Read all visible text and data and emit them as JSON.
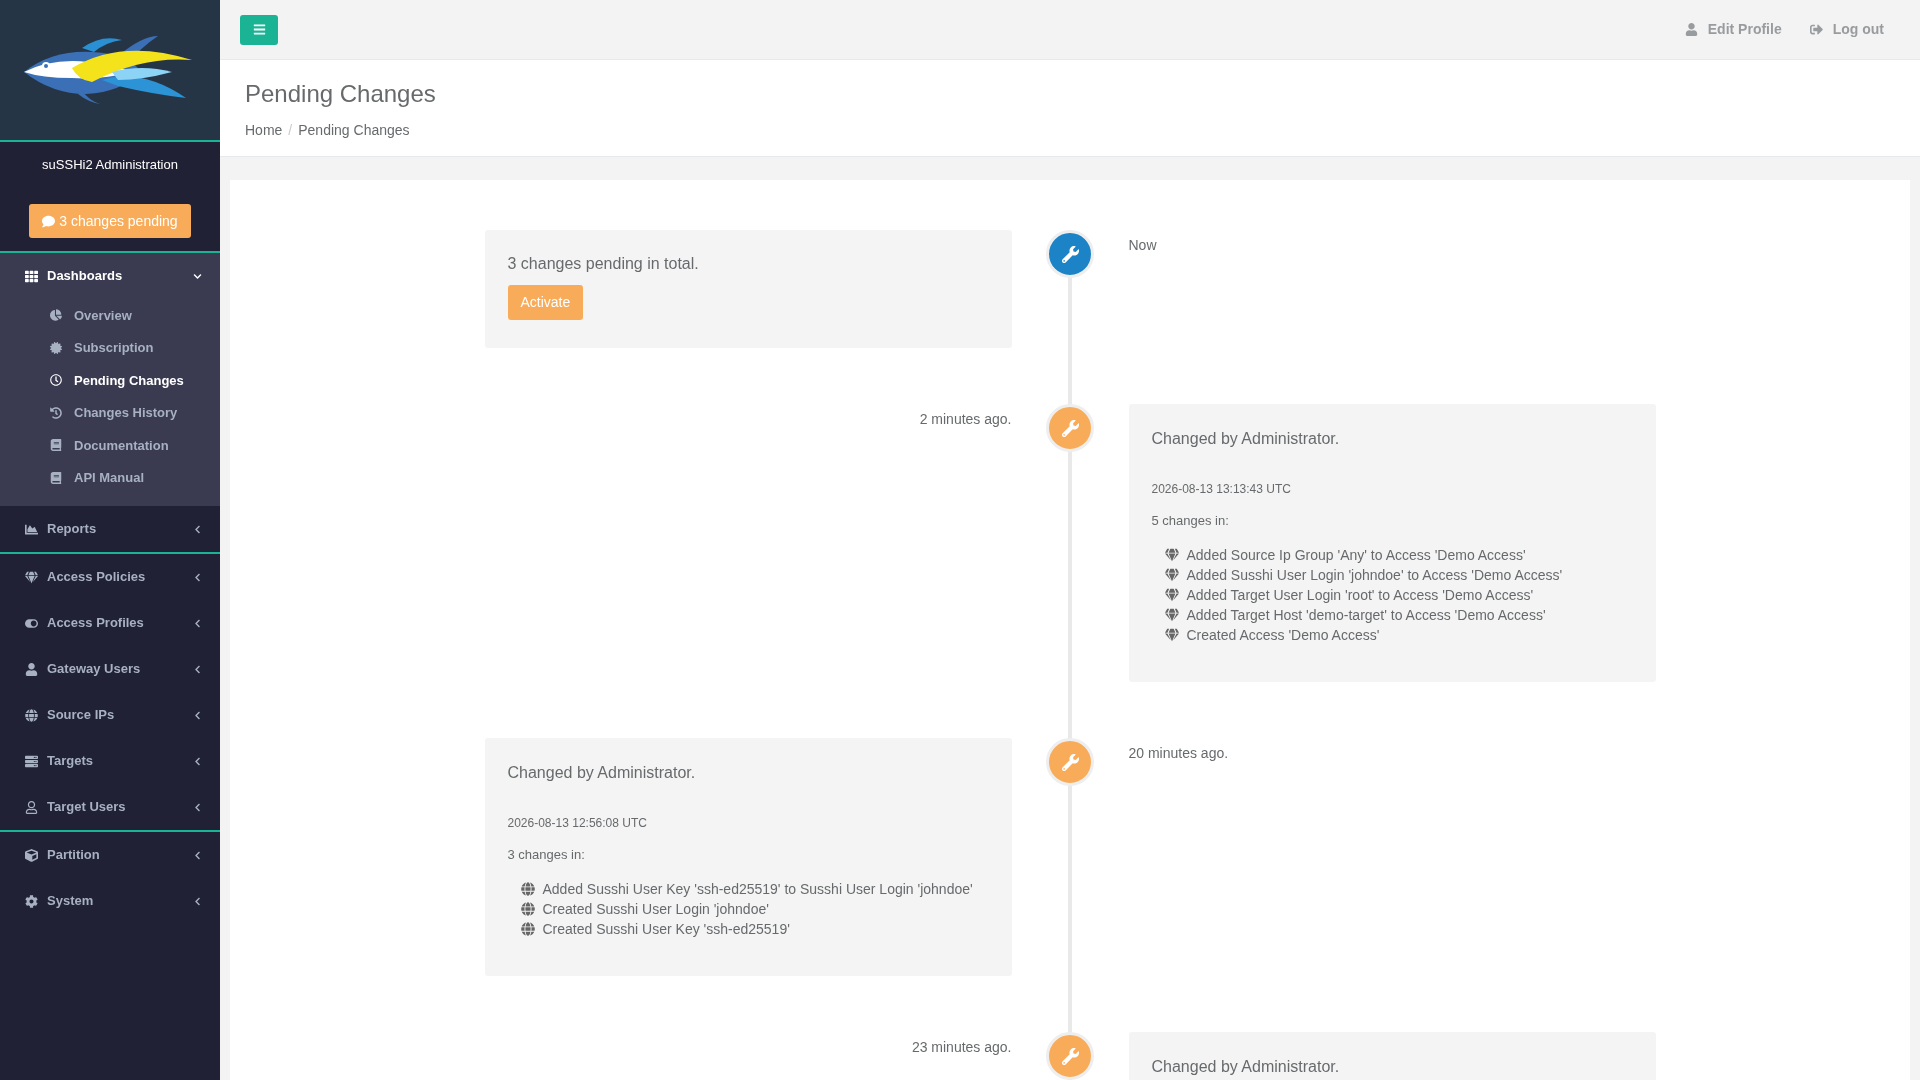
{
  "sidebar": {
    "title": "suSSHi2 Administration",
    "pending_button": "3 changes pending",
    "groups": [
      [
        {
          "label": "Dashboards",
          "expanded": true,
          "children": [
            {
              "label": "Overview",
              "selected": false
            },
            {
              "label": "Subscription",
              "selected": false
            },
            {
              "label": "Pending Changes",
              "selected": true
            },
            {
              "label": "Changes History",
              "selected": false
            },
            {
              "label": "Documentation",
              "selected": false
            },
            {
              "label": "API Manual",
              "selected": false
            }
          ]
        },
        {
          "label": "Reports",
          "expanded": false
        }
      ],
      [
        {
          "label": "Access Policies",
          "expanded": false
        },
        {
          "label": "Access Profiles",
          "expanded": false
        },
        {
          "label": "Gateway Users",
          "expanded": false
        },
        {
          "label": "Source IPs",
          "expanded": false
        },
        {
          "label": "Targets",
          "expanded": false
        },
        {
          "label": "Target Users",
          "expanded": false
        }
      ],
      [
        {
          "label": "Partition",
          "expanded": false
        },
        {
          "label": "System",
          "expanded": false
        }
      ]
    ]
  },
  "topbar": {
    "links": [
      "Edit Profile",
      "Log out"
    ]
  },
  "header": {
    "title": "Pending Changes",
    "breadcrumb": [
      "Home",
      "Pending Changes"
    ],
    "separator": "/"
  },
  "timeline": [
    {
      "kind": "pending",
      "color": "#1c84c6",
      "time": "Now",
      "text": "3 changes pending in total.",
      "button": "Activate"
    },
    {
      "kind": "change",
      "color": "#f8ac59",
      "time": "2 minutes ago.",
      "title": "Changed by Administrator.",
      "date": "2026-08-13 13:13:43 UTC",
      "count": "5 changes in:",
      "changes": [
        {
          "kind": "access",
          "text": "Added Source Ip Group 'Any' to Access 'Demo Access'"
        },
        {
          "kind": "access",
          "text": "Added Susshi User Login 'johndoe' to Access 'Demo Access'"
        },
        {
          "kind": "access",
          "text": "Added Target User Login 'root' to Access 'Demo Access'"
        },
        {
          "kind": "access",
          "text": "Added Target Host 'demo-target' to Access 'Demo Access'"
        },
        {
          "kind": "access",
          "text": "Created Access 'Demo Access'"
        }
      ]
    },
    {
      "kind": "change",
      "color": "#f8ac59",
      "time": "20 minutes ago.",
      "title": "Changed by Administrator.",
      "date": "2026-08-13 12:56:08 UTC",
      "count": "3 changes in:",
      "changes": [
        {
          "kind": "user",
          "text": "Added Susshi User Key 'ssh-ed25519' to Susshi User Login 'johndoe'"
        },
        {
          "kind": "user",
          "text": "Created Susshi User Login 'johndoe'"
        },
        {
          "kind": "user",
          "text": "Created Susshi User Key 'ssh-ed25519'"
        }
      ]
    },
    {
      "kind": "change",
      "color": "#f8ac59",
      "time": "23 minutes ago.",
      "title": "Changed by Administrator."
    }
  ]
}
